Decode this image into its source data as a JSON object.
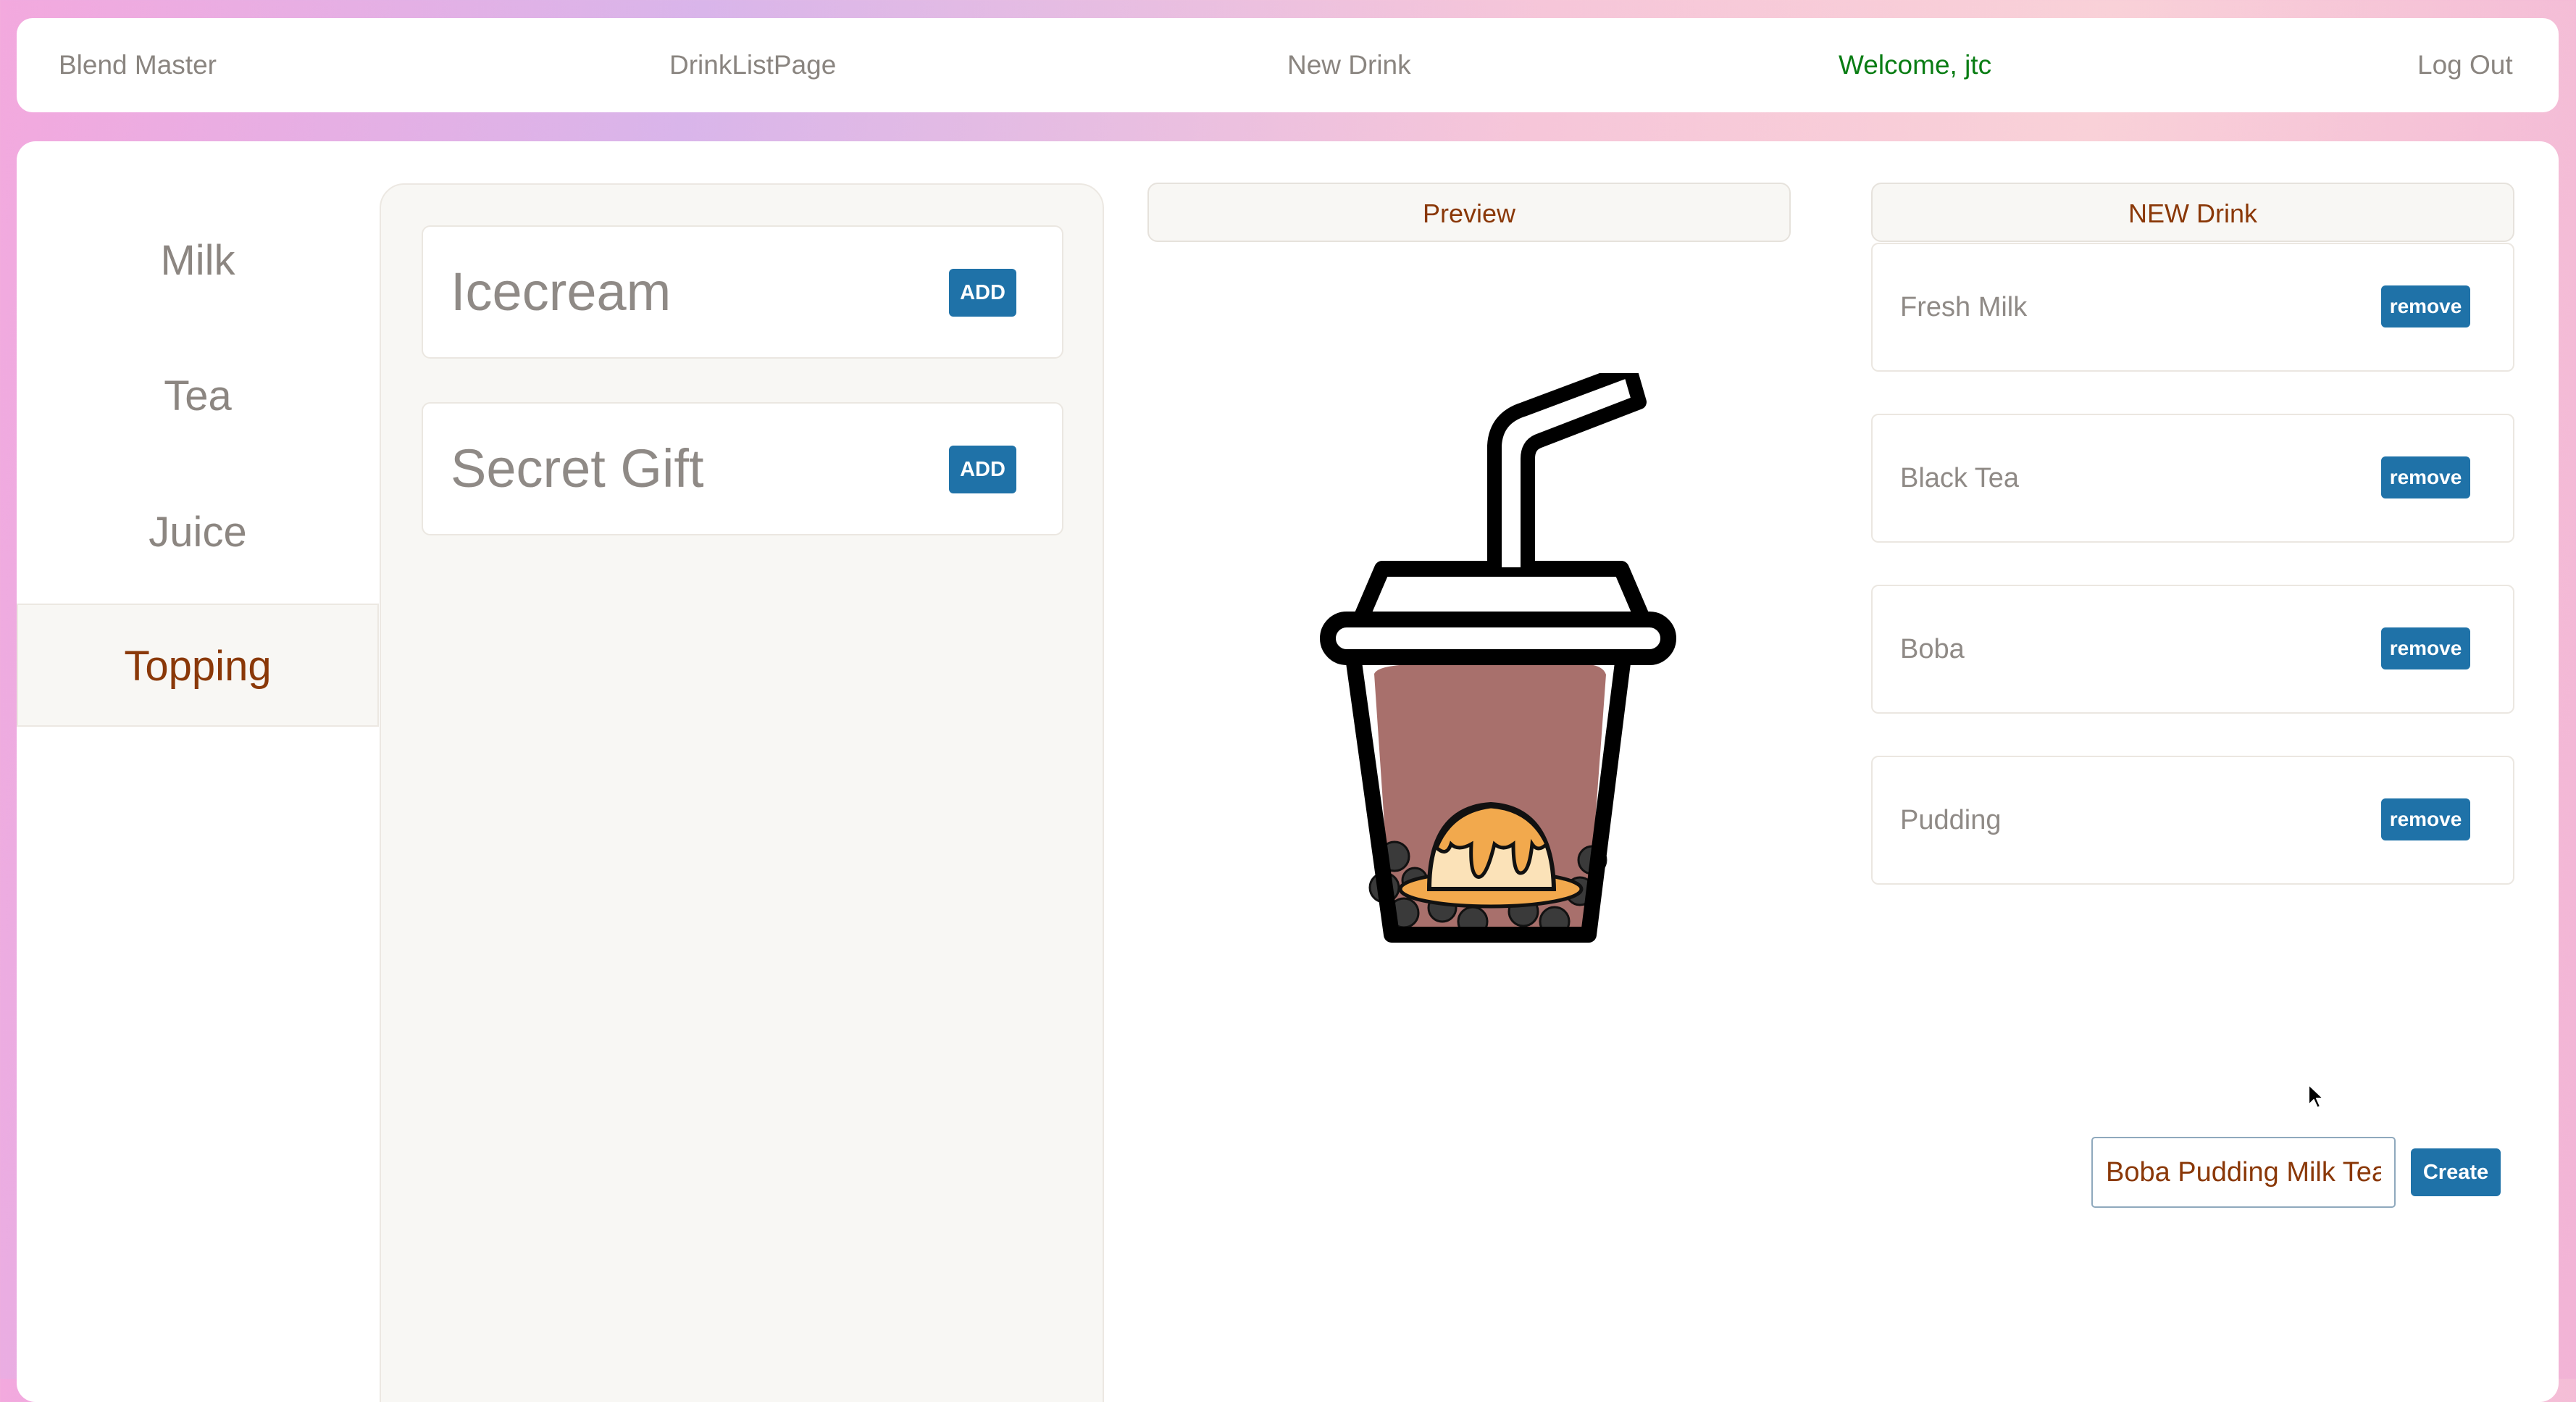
{
  "nav": {
    "brand": "Blend Master",
    "drink_list": "DrinkListPage",
    "new_drink": "New Drink",
    "welcome": "Welcome, jtc",
    "logout": "Log Out"
  },
  "categories": [
    {
      "label": "Milk",
      "active": false
    },
    {
      "label": "Tea",
      "active": false
    },
    {
      "label": "Juice",
      "active": false
    },
    {
      "label": "Topping",
      "active": true
    }
  ],
  "items": [
    {
      "name": "Icecream",
      "button": "ADD"
    },
    {
      "name": "Secret Gift",
      "button": "ADD"
    }
  ],
  "preview": {
    "header": "Preview",
    "icon": "bubble-tea-cup-icon"
  },
  "new_drink_panel": {
    "header": "NEW Drink",
    "ingredients": [
      {
        "name": "Fresh Milk",
        "button": "remove"
      },
      {
        "name": "Black Tea",
        "button": "remove"
      },
      {
        "name": "Boba",
        "button": "remove"
      },
      {
        "name": "Pudding",
        "button": "remove"
      }
    ],
    "name_input_value": "Boba Pudding Milk Tea",
    "create_label": "Create"
  },
  "colors": {
    "accent_button": "#1f72a8",
    "active_text": "#8a3808",
    "welcome_text": "#0a7d14",
    "tea_fill": "#a8706c"
  }
}
